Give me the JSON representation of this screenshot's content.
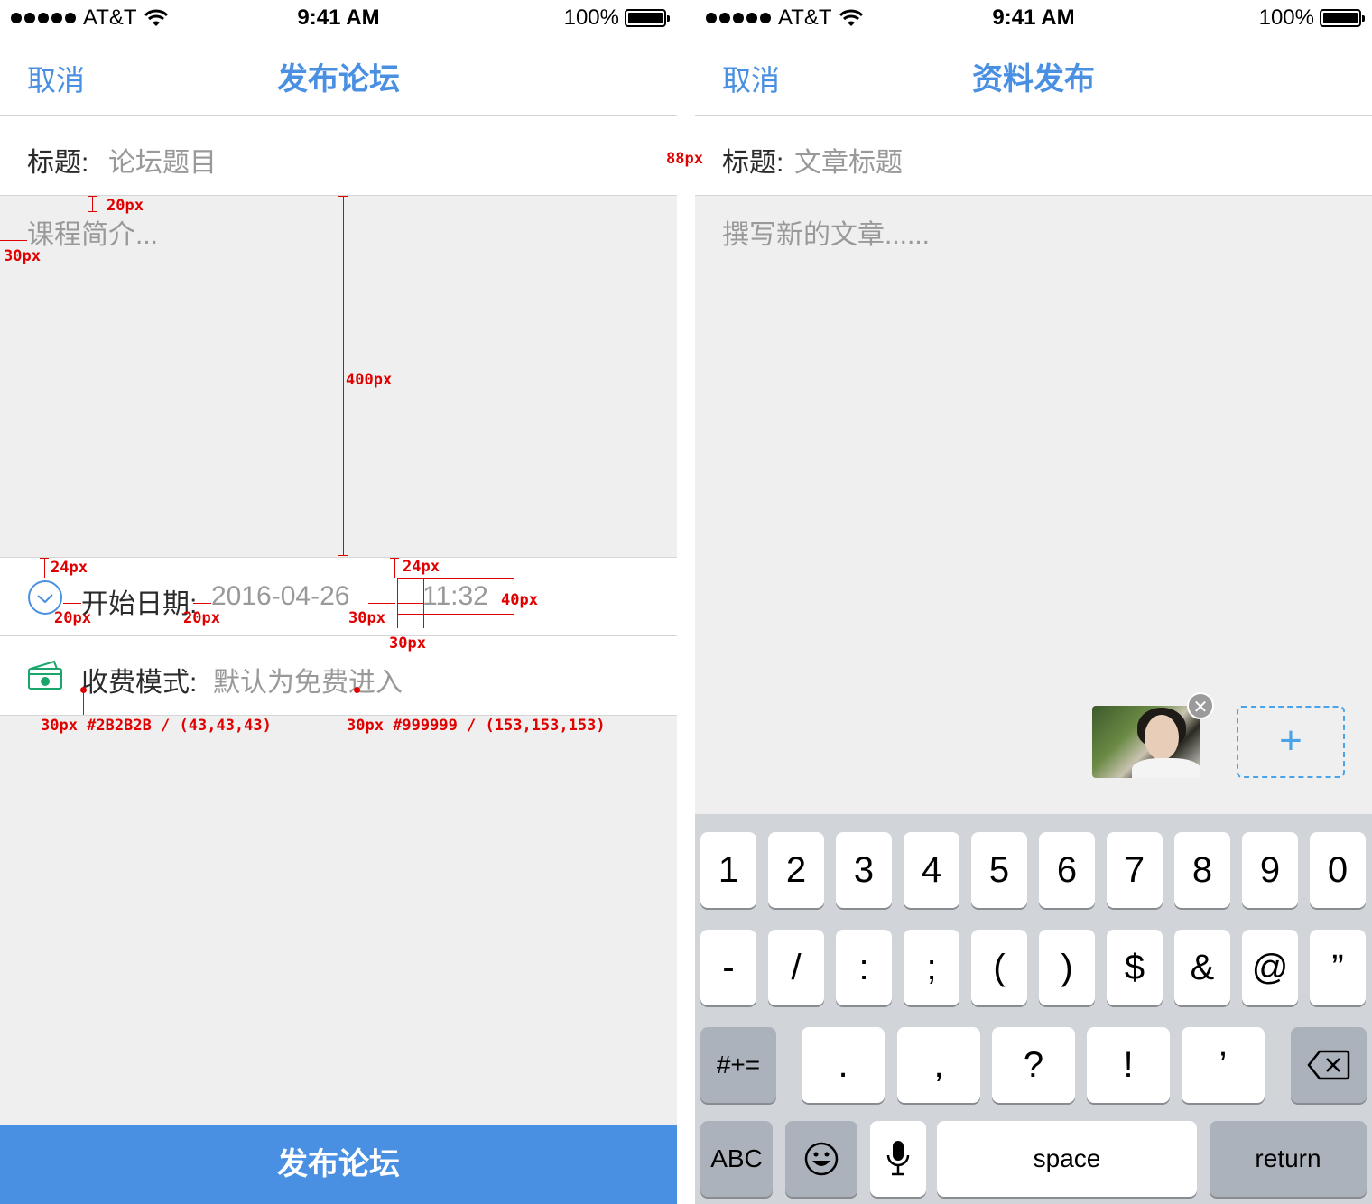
{
  "status_bar": {
    "carrier": "AT&T",
    "time": "9:41 AM",
    "battery": "100%"
  },
  "left_screen": {
    "nav": {
      "cancel": "取消",
      "title": "发布论坛"
    },
    "title_row": {
      "label": "标题:",
      "placeholder": "论坛题目"
    },
    "body_placeholder": "课程简介...",
    "date_row": {
      "label": "开始日期:",
      "date": "2016-04-26",
      "time": "11:32"
    },
    "fee_row": {
      "label": "收费模式:",
      "value": "默认为免费进入"
    },
    "submit_label": "发布论坛"
  },
  "right_screen": {
    "nav": {
      "cancel": "取消",
      "title": "资料发布"
    },
    "title_row": {
      "label": "标题:",
      "placeholder": "文章标题"
    },
    "body_placeholder": "撰写新的文章......",
    "add_symbol": "+",
    "keyboard": {
      "row1": [
        "1",
        "2",
        "3",
        "4",
        "5",
        "6",
        "7",
        "8",
        "9",
        "0"
      ],
      "row2": [
        "-",
        "/",
        ":",
        ";",
        "(",
        ")",
        "$",
        "&",
        "@",
        "”"
      ],
      "row3": [
        ".",
        ",",
        "?",
        "!",
        "’"
      ],
      "symbols_key": "#+=",
      "abc_key": "ABC",
      "space_key": "space",
      "return_key": "return"
    }
  },
  "annotations": {
    "a1": "88px",
    "a2": "20px",
    "a3": "30px",
    "a4": "400px",
    "a5": "24px",
    "a6": "24px",
    "a7": "20px",
    "a8": "20px",
    "a9": "30px",
    "a10": "30px",
    "a11": "40px",
    "a12": "30px #2B2B2B / (43,43,43)",
    "a13": "30px #999999 / (153,153,153)"
  },
  "colors": {
    "accent": "#4a90e2",
    "text_dark": "#2b2b2b",
    "text_muted": "#999999",
    "annotation": "#e00000"
  }
}
